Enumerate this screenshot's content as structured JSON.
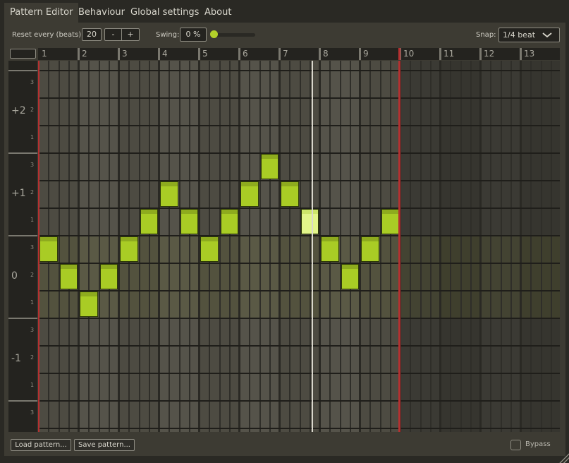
{
  "tabs": [
    {
      "label": "Pattern Editor",
      "active": true
    },
    {
      "label": "Behaviour",
      "active": false
    },
    {
      "label": "Global settings",
      "active": false
    },
    {
      "label": "About",
      "active": false
    }
  ],
  "toolbar": {
    "reset_label": "Reset every (beats):",
    "reset_value": "20",
    "minus_label": "-",
    "plus_label": "+",
    "swing_label": "Swing:",
    "swing_value": "0 %",
    "swing_slider_value": 0,
    "snap_label": "Snap:",
    "snap_value": "1/4 beat",
    "snap_icon": "chevron-down-icon"
  },
  "ruler": {
    "beats": [
      "1",
      "2",
      "3",
      "4",
      "5",
      "6",
      "7",
      "8",
      "9",
      "10",
      "11",
      "12",
      "13"
    ]
  },
  "rows": {
    "octaves": [
      {
        "label": "+2",
        "subs": [
          "3",
          "2",
          "1"
        ]
      },
      {
        "label": "+1",
        "subs": [
          "3",
          "2",
          "1"
        ]
      },
      {
        "label": "0",
        "subs": [
          "3",
          "2",
          "1"
        ]
      },
      {
        "label": "-1",
        "subs": [
          "3",
          "2",
          "1"
        ]
      },
      {
        "label": "",
        "subs": [
          "3"
        ]
      }
    ]
  },
  "grid": {
    "subdivisions_per_beat": 4,
    "loop_end_beat": 9,
    "playhead_beat": 6.8,
    "notes": [
      {
        "step": 0,
        "octave": "0",
        "sub": 3
      },
      {
        "step": 1,
        "octave": "0",
        "sub": 2
      },
      {
        "step": 2,
        "octave": "0",
        "sub": 1
      },
      {
        "step": 3,
        "octave": "0",
        "sub": 2
      },
      {
        "step": 4,
        "octave": "0",
        "sub": 3
      },
      {
        "step": 5,
        "octave": "+1",
        "sub": 1
      },
      {
        "step": 6,
        "octave": "+1",
        "sub": 2
      },
      {
        "step": 7,
        "octave": "+1",
        "sub": 1
      },
      {
        "step": 8,
        "octave": "0",
        "sub": 3
      },
      {
        "step": 9,
        "octave": "+1",
        "sub": 1
      },
      {
        "step": 10,
        "octave": "+1",
        "sub": 2
      },
      {
        "step": 11,
        "octave": "+1",
        "sub": 3
      },
      {
        "step": 12,
        "octave": "+1",
        "sub": 2
      },
      {
        "step": 13,
        "octave": "+1",
        "sub": 1,
        "playing": true
      },
      {
        "step": 14,
        "octave": "0",
        "sub": 3
      },
      {
        "step": 15,
        "octave": "0",
        "sub": 2
      },
      {
        "step": 16,
        "octave": "0",
        "sub": 3
      },
      {
        "step": 17,
        "octave": "+1",
        "sub": 1
      }
    ],
    "colors": {
      "note": "#a9cc25",
      "note_top": "#8eab1e",
      "note_playing": "#e2f58a",
      "loop_end": "#b53030",
      "playhead": "#d8d6cc"
    }
  },
  "footer": {
    "load_label": "Load pattern...",
    "save_label": "Save pattern...",
    "bypass_label": "Bypass",
    "bypass_checked": false
  }
}
